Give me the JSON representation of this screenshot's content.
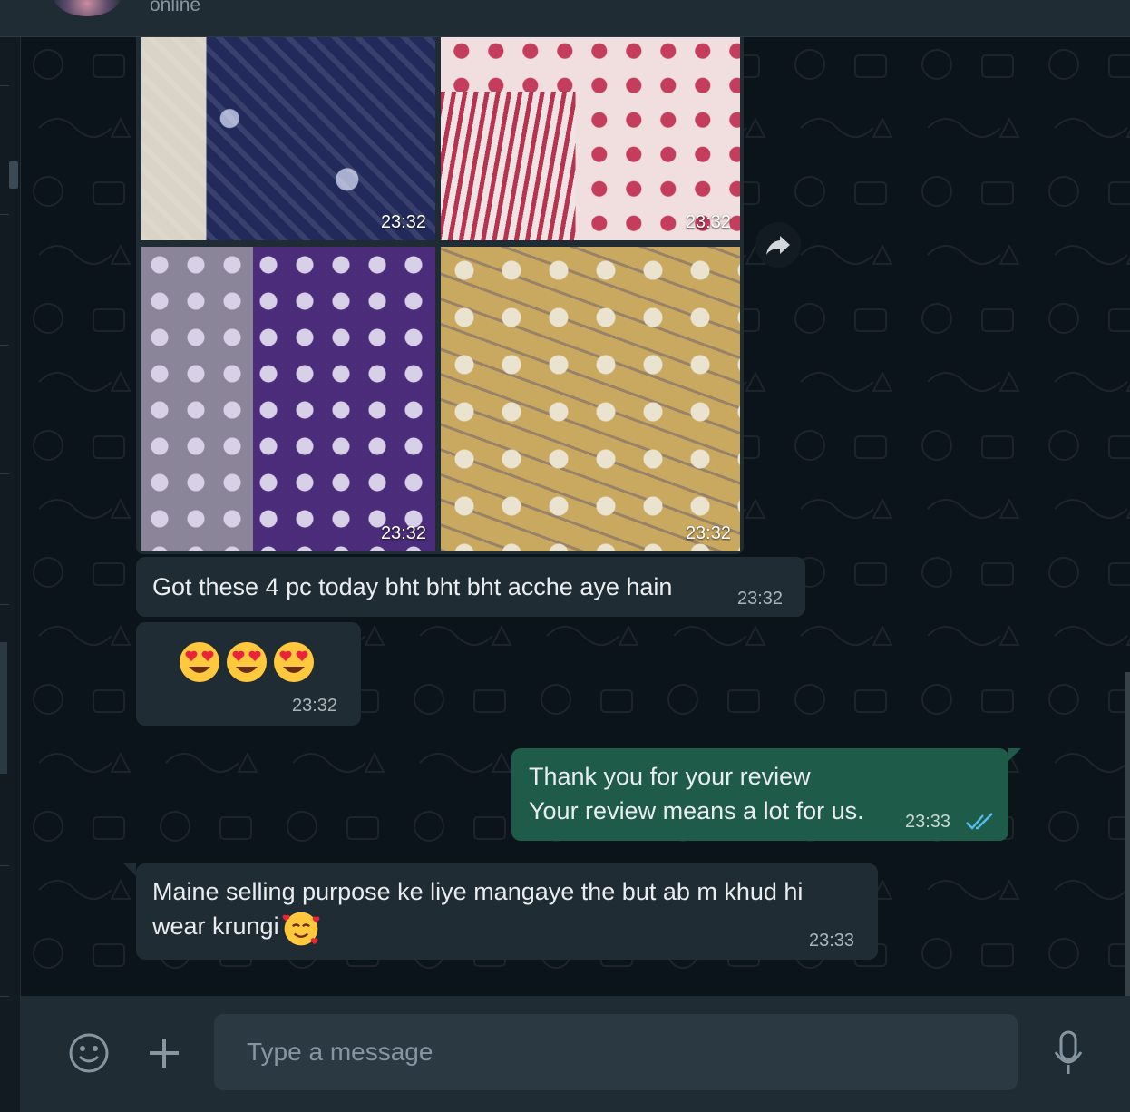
{
  "header": {
    "contact_status": "online"
  },
  "album": {
    "photos": [
      {
        "time": "23:32"
      },
      {
        "time": "23:32"
      },
      {
        "time": "23:32"
      },
      {
        "time": "23:32"
      }
    ]
  },
  "messages": [
    {
      "direction": "incoming",
      "text": "Got these 4 pc today bht bht bht acche aye hain",
      "time": "23:32"
    },
    {
      "direction": "incoming",
      "emoji": [
        "heart-eyes-emoji",
        "heart-eyes-emoji",
        "heart-eyes-emoji"
      ],
      "time": "23:32"
    },
    {
      "direction": "outgoing",
      "text": "Thank you for your review\nYour review means a lot for us.",
      "time": "23:33",
      "status": "read"
    },
    {
      "direction": "incoming",
      "text": "Maine selling purpose ke liye mangaye the but ab m khud hi\nwear krungi",
      "emoji": "smiling-face-with-hearts-emoji",
      "time": "23:33"
    }
  ],
  "composer": {
    "placeholder": "Type a message"
  },
  "colors": {
    "background": "#0b141a",
    "incoming_bubble": "#202c33",
    "outgoing_bubble": "#1f5b49",
    "read_ticks": "#53bdeb"
  }
}
